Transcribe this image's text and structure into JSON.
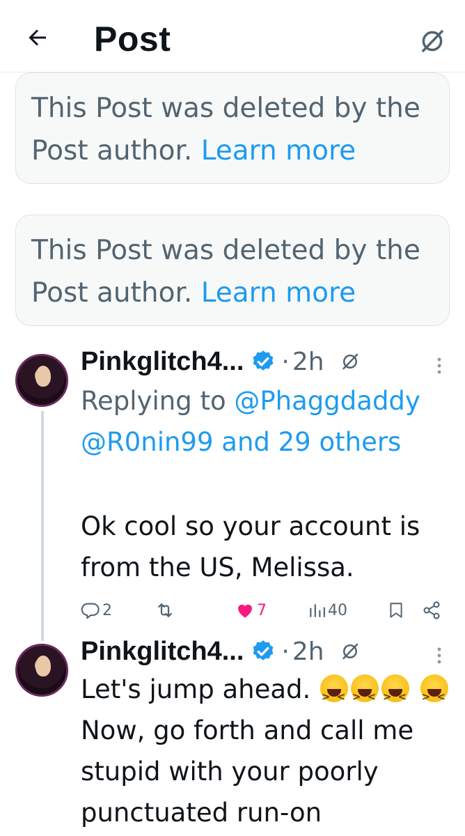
{
  "header": {
    "title": "Post",
    "back_icon": "arrow-left-icon",
    "translate_icon": "grok-icon"
  },
  "deleted_posts": [
    {
      "message": "This Post was deleted by the Post author.",
      "link": "Learn more"
    },
    {
      "message": "This Post was deleted by the Post author.",
      "link": "Learn more"
    }
  ],
  "tweets": [
    {
      "author": "Pinkglitch4...",
      "separator": "·",
      "time": "2h",
      "replying_prefix": "Replying to",
      "reply_handles": [
        "@Phaggdaddy",
        "@R0nin99 and 29 others"
      ],
      "text": "Ok cool so your account is from the US, Melissa.",
      "actions": {
        "replies": "2",
        "reposts": "",
        "likes": "7",
        "views": "40"
      }
    },
    {
      "author": "Pinkglitch4...",
      "separator": "·",
      "time": "2h",
      "text_part1": "Let's jump ahead.",
      "text_part2": "Now, go forth and call me stupid with your poorly punctuated run-on",
      "emoji_name": "grinning-squinting-face"
    }
  ],
  "colors": {
    "accent": "#1d9bf0",
    "secondary_text": "#536471",
    "like": "#f91880",
    "card_bg": "#f7f9f9"
  }
}
